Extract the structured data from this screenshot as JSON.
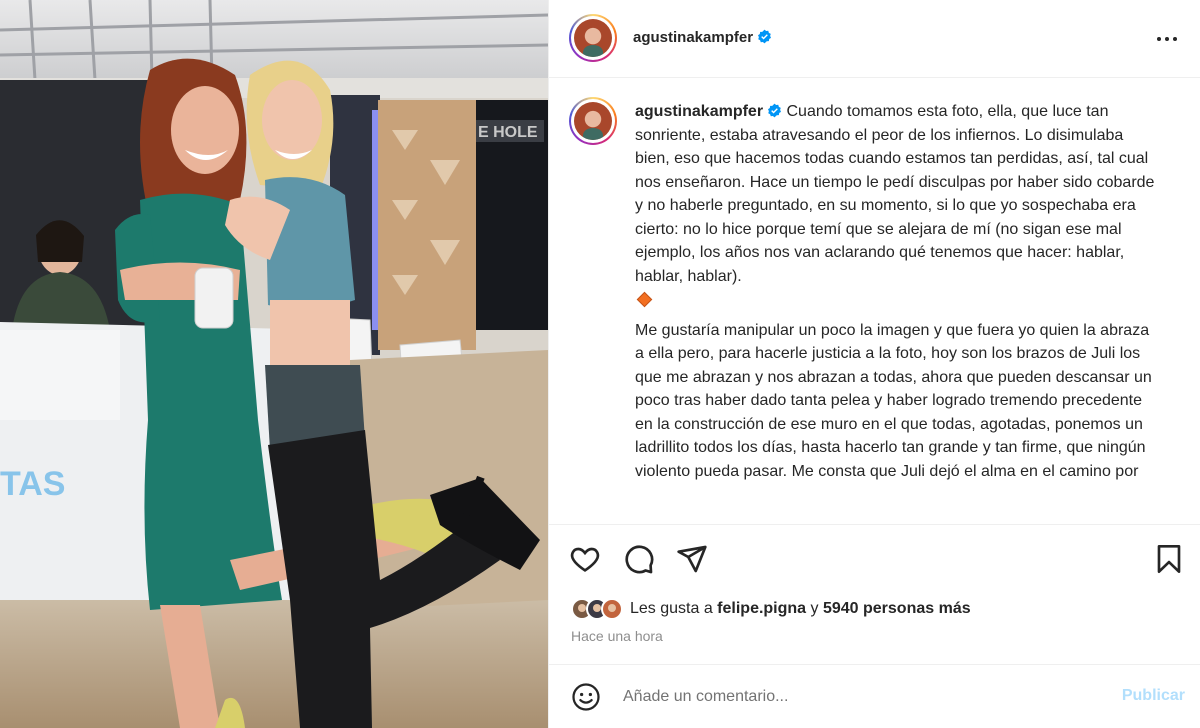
{
  "post": {
    "image_alt": "Dos mujeres abrazadas en un set de televisión"
  },
  "header": {
    "username": "agustinakampfer",
    "verified": true,
    "avatar_icon": "profile-avatar",
    "more_icon": "more-options-icon"
  },
  "caption": {
    "username": "agustinakampfer",
    "text_1": "Cuando tomamos esta foto, ella, que luce tan sonriente, estaba atravesando el peor de los infiernos. Lo disimulaba bien, eso que hacemos todas cuando estamos tan perdidas, así, tal cual nos enseñaron. Hace un tiempo le pedí disculpas por haber sido cobarde y no haberle preguntado, en su momento, si lo que yo sospechaba era cierto: no lo hice porque temí que se alejara de mí (no sigan ese mal ejemplo, los años nos van aclarando qué tenemos que hacer: hablar, hablar, hablar).",
    "emoji": "orange-diamond",
    "text_2": "Me gustaría manipular un poco la imagen y que fuera yo quien la abraza a ella pero, para hacerle justicia a la foto, hoy son los brazos de Juli los que me abrazan y nos abrazan a todas, ahora que pueden descansar un poco tras haber dado tanta pelea y haber logrado tremendo precedente en la construcción de ese muro en el que todas, agotadas, ponemos un ladrillito todos los días, hasta hacerlo tan grande y tan firme, que ningún violento pueda pasar. Me consta que Juli dejó el alma en el camino por"
  },
  "actions": {
    "like_icon": "heart-icon",
    "comment_icon": "comment-icon",
    "share_icon": "send-icon",
    "save_icon": "bookmark-icon"
  },
  "likes": {
    "prefix": "Les gusta a ",
    "user": "felipe.pigna",
    "middle": " y ",
    "count": "5940 personas más"
  },
  "timestamp": "Hace una hora",
  "comment": {
    "placeholder": "Añade un comentario...",
    "publish_label": "Publicar",
    "emoji_icon": "emoji-icon"
  },
  "colors": {
    "accent": "#0095f6",
    "publish_disabled": "#b2dffc",
    "muted": "#8e8e8e"
  }
}
